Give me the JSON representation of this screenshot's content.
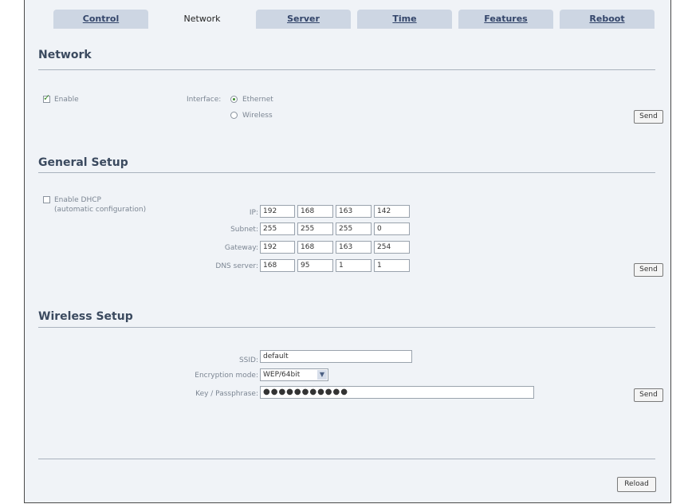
{
  "tabs": [
    {
      "label": "Control",
      "active": false
    },
    {
      "label": "Network",
      "active": true
    },
    {
      "label": "Server",
      "active": false
    },
    {
      "label": "Time",
      "active": false
    },
    {
      "label": "Features",
      "active": false
    },
    {
      "label": "Reboot",
      "active": false
    }
  ],
  "network": {
    "title": "Network",
    "enable_label": "Enable",
    "enable_checked": true,
    "interface_label": "Interface:",
    "ethernet_label": "Ethernet",
    "wireless_label": "Wireless",
    "selected_interface": "Ethernet",
    "send_label": "Send"
  },
  "general": {
    "title": "General Setup",
    "dhcp_label": "Enable DHCP",
    "dhcp_sublabel": "(automatic configuration)",
    "dhcp_checked": false,
    "ip_label": "IP:",
    "subnet_label": "Subnet:",
    "gateway_label": "Gateway:",
    "dns_label": "DNS server:",
    "ip": [
      "192",
      "168",
      "163",
      "142"
    ],
    "subnet": [
      "255",
      "255",
      "255",
      "0"
    ],
    "gateway": [
      "192",
      "168",
      "163",
      "254"
    ],
    "dns": [
      "168",
      "95",
      "1",
      "1"
    ],
    "send_label": "Send"
  },
  "wireless": {
    "title": "Wireless Setup",
    "ssid_label": "SSID:",
    "ssid_value": "default",
    "encryption_label": "Encryption mode:",
    "encryption_value": "WEP/64bit",
    "key_label": "Key / Passphrase:",
    "key_value": "●●●●●●●●●●●",
    "send_label": "Send"
  },
  "footer": {
    "reload_label": "Reload"
  },
  "colors": {
    "panel_bg": "#f0f3f7",
    "tab_bg": "#cdd6e3",
    "title_color": "#3b4a5f",
    "accent_green": "#3a8a2a"
  }
}
